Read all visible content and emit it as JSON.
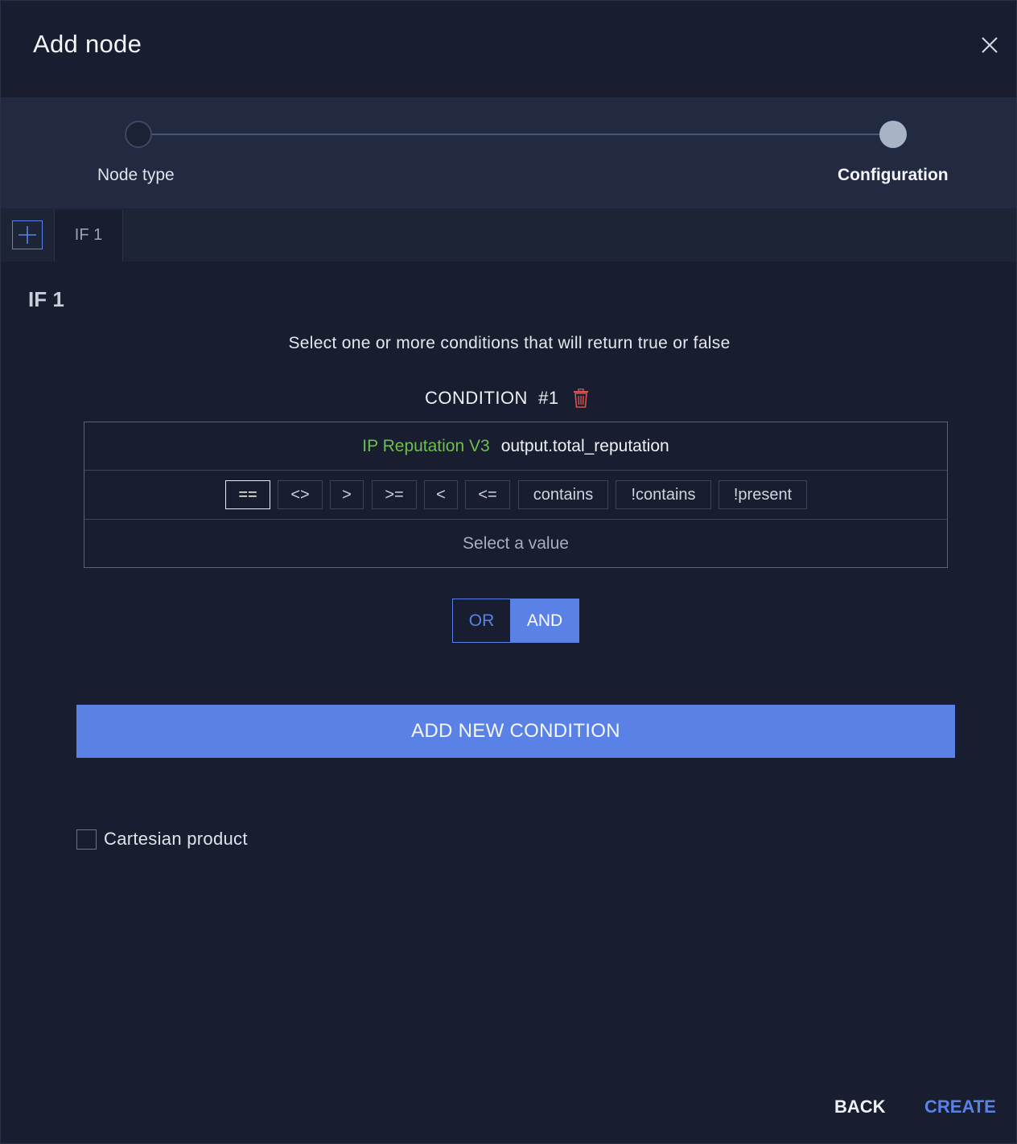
{
  "header": {
    "title": "Add node",
    "close_icon": "close-icon"
  },
  "stepper": {
    "steps": [
      {
        "label": "Node type",
        "state": "done"
      },
      {
        "label": "Configuration",
        "state": "active"
      }
    ]
  },
  "tabs": {
    "add_icon": "plus-icon",
    "items": [
      {
        "label": "IF 1"
      }
    ]
  },
  "section": {
    "title": "IF 1",
    "instruction": "Select one or more conditions that will return true or false"
  },
  "condition": {
    "label": "CONDITION  #1",
    "delete_icon": "trash-icon",
    "source": "IP Reputation V3",
    "field": "output.total_reputation",
    "operators": [
      "==",
      "<>",
      ">",
      ">=",
      "<",
      "<=",
      "contains",
      "!contains",
      "!present"
    ],
    "selected_operator": "==",
    "value_placeholder": "Select a value"
  },
  "logic": {
    "or_label": "OR",
    "and_label": "AND",
    "selected": "AND"
  },
  "add_condition_label": "ADD NEW CONDITION",
  "cartesian": {
    "label": "Cartesian product",
    "checked": false
  },
  "footer": {
    "back_label": "BACK",
    "create_label": "CREATE"
  },
  "colors": {
    "background": "#181e2f",
    "stepper_bg": "#212a40",
    "accent": "#5a82e6",
    "source_green": "#6fbd4f",
    "danger": "#d9534f"
  }
}
